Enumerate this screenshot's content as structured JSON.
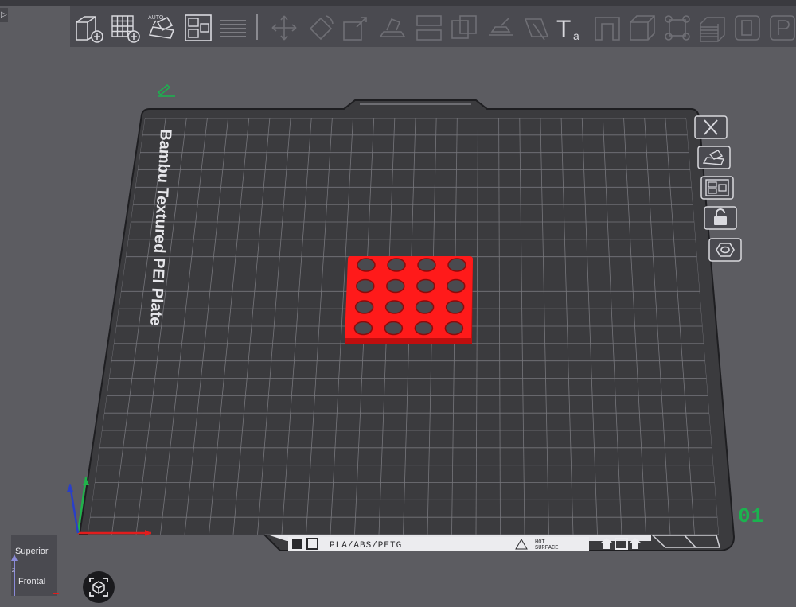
{
  "toolbar": {
    "tools": [
      {
        "name": "add-object",
        "label": "Add"
      },
      {
        "name": "add-plate",
        "label": "Add plate"
      },
      {
        "name": "auto-orient",
        "label": "AUTO"
      },
      {
        "name": "arrange",
        "label": "Arrange"
      },
      {
        "name": "split",
        "label": "Split"
      }
    ],
    "auto_label": "AUTO",
    "text_tool_label": "T",
    "text_tool_sub": "a"
  },
  "plate": {
    "name": "Bambu Textured PEI Plate",
    "number": "01",
    "filament_info": "PLA/ABS/PETG",
    "hot_surface": [
      "HOT",
      "SURFACE"
    ]
  },
  "view_cube": {
    "top_label": "Superior",
    "front_label": "Frontal",
    "axis_label": "Z"
  },
  "model": {
    "color": "#ff1a1a",
    "hole_grid": [
      4,
      4
    ]
  },
  "colors": {
    "accent_green": "#1bb34f",
    "bed": "#3b3b3e",
    "background": "#5c5c61"
  }
}
